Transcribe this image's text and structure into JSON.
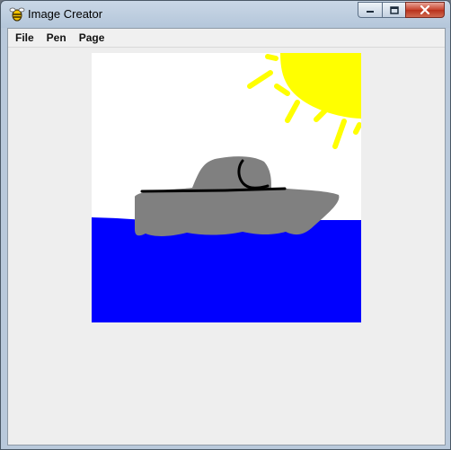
{
  "window": {
    "title": "Image Creator",
    "icon": "bee-icon",
    "controls": [
      "minimize-icon",
      "maximize-icon",
      "close-icon"
    ]
  },
  "menu": {
    "items": [
      {
        "label": "File"
      },
      {
        "label": "Pen"
      },
      {
        "label": "Page"
      }
    ]
  },
  "canvas": {
    "background": "#ffffff",
    "colors": {
      "sea": "#0000ff",
      "sun": "#ffff00",
      "boat": "#808080",
      "ink": "#000000"
    }
  }
}
